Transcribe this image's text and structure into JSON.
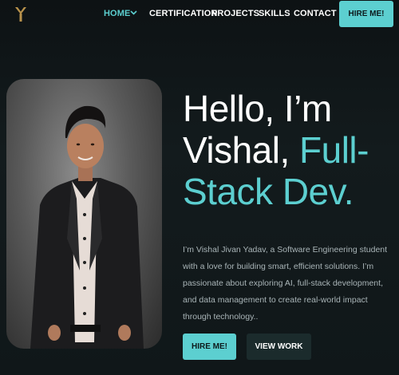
{
  "nav": {
    "logo_letter": "Y",
    "items": [
      {
        "label": "HOME"
      },
      {
        "label": "CERTIFICATION"
      },
      {
        "label": "PROJECTS"
      },
      {
        "label": "SKILLS"
      },
      {
        "label": "CONTACT"
      }
    ],
    "cta_label": "HIRE ME!"
  },
  "hero": {
    "line1": "Hello, I’m",
    "line2_name": "Vishal, ",
    "line2_accent": "Full-",
    "line3_accent": "Stack Dev.",
    "bio": "I’m Vishal Jivan Yadav, a Software Engineering student with a love for building smart, efficient solutions. I’m passionate about exploring AI, full-stack development, and data management to create real-world impact through technology..",
    "hire_label": "HIRE ME!",
    "work_label": "VIEW WORK"
  },
  "colors": {
    "accent": "#5ccfd0",
    "background": "#0d1214",
    "logo": "#b8924c"
  },
  "icons": {
    "logo": "y-logo-icon",
    "home_dropdown": "chevron-down-icon"
  }
}
